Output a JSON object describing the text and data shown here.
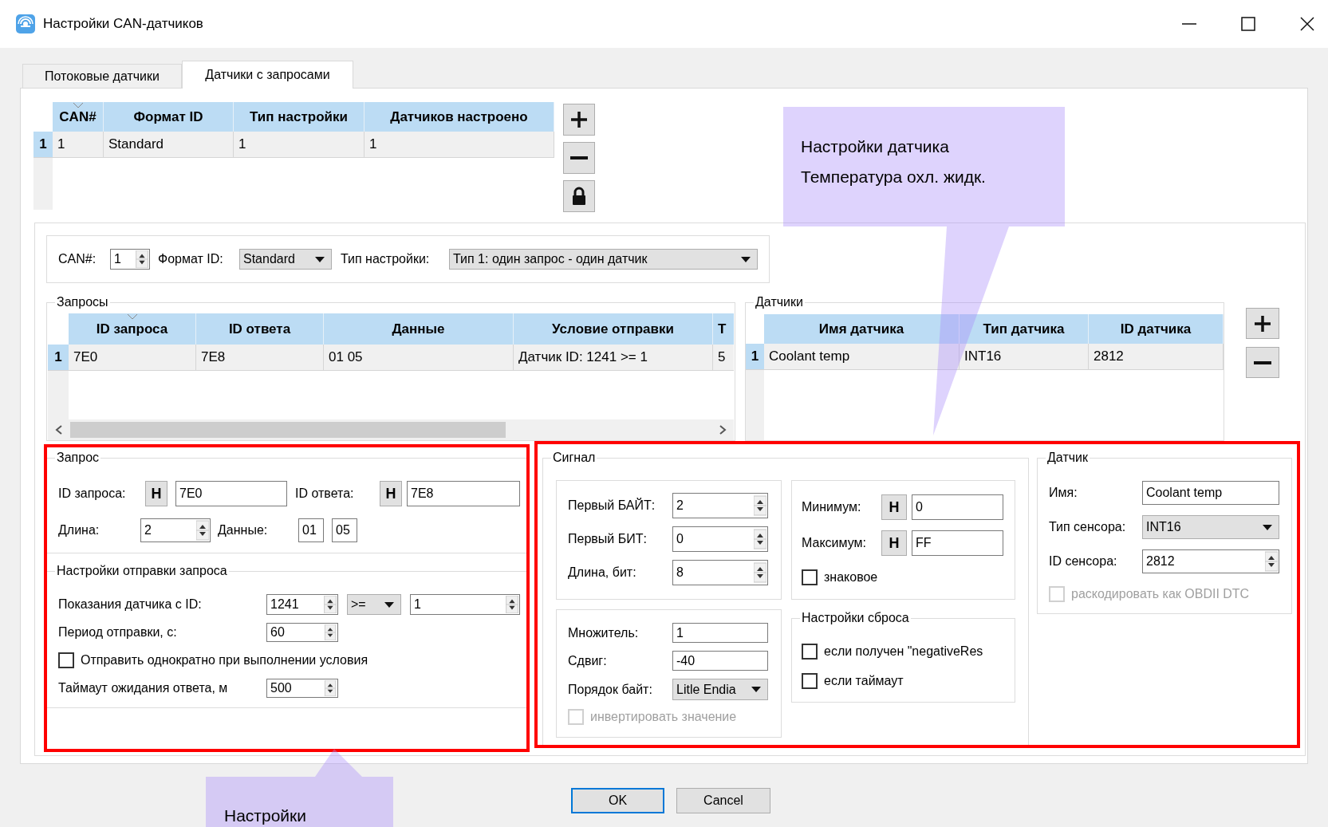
{
  "window": {
    "title": "Настройки CAN-датчиков"
  },
  "tabs": [
    {
      "label": "Потоковые датчики",
      "selected": false
    },
    {
      "label": "Датчики с запросами",
      "selected": true
    }
  ],
  "can_table": {
    "columns": [
      "CAN#",
      "Формат ID",
      "Тип настройки",
      "Датчиков настроено"
    ],
    "rows": [
      {
        "number": "1",
        "selected": true,
        "cells": [
          "1",
          "Standard",
          "1",
          "1"
        ]
      }
    ]
  },
  "settings_bar": {
    "can_label": "CAN#:",
    "can_value": "1",
    "id_format_label": "Формат ID:",
    "id_format_value": "Standard",
    "setup_type_label": "Тип настройки:",
    "setup_type_value": "Тип 1: один запрос - один датчик"
  },
  "requests": {
    "title": "Запросы",
    "columns": [
      "ID запроса",
      "ID ответа",
      "Данные",
      "Условие отправки",
      "Т"
    ],
    "rows": [
      {
        "number": "1",
        "selected": true,
        "cells": [
          "7E0",
          "7E8",
          "01 05",
          "Датчик ID: 1241 >= 1",
          "5"
        ]
      }
    ]
  },
  "sensors": {
    "title": "Датчики",
    "columns": [
      "Имя датчика",
      "Тип датчика",
      "ID датчика"
    ],
    "rows": [
      {
        "number": "1",
        "selected": true,
        "cells": [
          "Coolant temp",
          "INT16",
          "2812"
        ]
      }
    ]
  },
  "request_panel": {
    "title": "Запрос",
    "request_id_label": "ID запроса:",
    "request_id_hex": "H",
    "request_id": "7E0",
    "response_id_label": "ID ответа:",
    "response_id_hex": "H",
    "response_id": "7E8",
    "length_label": "Длина:",
    "length": "2",
    "data_label": "Данные:",
    "data_bytes": [
      "01",
      "05"
    ],
    "send_settings": {
      "title": "Настройки отправки запроса",
      "sensor_label": "Показания датчика с ID:",
      "sensor_id": "1241",
      "operator": ">=",
      "threshold": "1",
      "period_label": "Период отправки, с:",
      "period": "60",
      "send_once": {
        "label": "Отправить однократно при выполнении условия",
        "checked": false,
        "disabled": false
      },
      "timeout_label": "Таймаут ожидания ответа, м",
      "timeout": "500"
    }
  },
  "signal_panel": {
    "title": "Сигнал",
    "position_fields": [
      {
        "label": "Первый БАЙТ:",
        "value": "2"
      },
      {
        "label": "Первый БИТ:",
        "value": "0"
      },
      {
        "label": "Длина, бит:",
        "value": "8"
      }
    ],
    "range_fields": [
      {
        "label": "Минимум:",
        "hex": "H",
        "value": "0"
      },
      {
        "label": "Максимум:",
        "hex": "H",
        "value": "FF"
      }
    ],
    "signed": {
      "label": "знаковое",
      "checked": false,
      "disabled": false
    },
    "scale_fields": [
      {
        "kind": "text",
        "label": "Множитель:",
        "value": "1"
      },
      {
        "kind": "text",
        "label": "Сдвиг:",
        "value": "-40"
      },
      {
        "kind": "dropdown",
        "label": "Порядок байт:",
        "value": "Litle Endia"
      }
    ],
    "invert": {
      "label": "инвертировать значение",
      "checked": false,
      "disabled": true
    },
    "reset": {
      "title": "Настройки сброса",
      "options": [
        {
          "label": "если получен \"negativeRes",
          "checked": false,
          "disabled": false
        },
        {
          "label": "если таймаут",
          "checked": false,
          "disabled": false
        }
      ]
    }
  },
  "sensor_panel": {
    "title": "Датчик",
    "fields": [
      {
        "kind": "text",
        "label": "Имя:",
        "value": "Coolant temp"
      },
      {
        "kind": "dropdown",
        "label": "Тип сенсора:",
        "value": "INT16"
      },
      {
        "kind": "spin",
        "label": "ID сенсора:",
        "value": "2812"
      }
    ],
    "decode_dtc": {
      "label": "раскодировать как OBDII DTC",
      "checked": false,
      "disabled": true
    }
  },
  "buttons": [
    {
      "label": "OK",
      "default": true
    },
    {
      "label": "Cancel",
      "default": false
    }
  ],
  "callouts": [
    {
      "lines": [
        "Настройки датчика",
        "Температура охл. жидк."
      ]
    },
    {
      "lines": [
        "Настройки"
      ]
    }
  ]
}
